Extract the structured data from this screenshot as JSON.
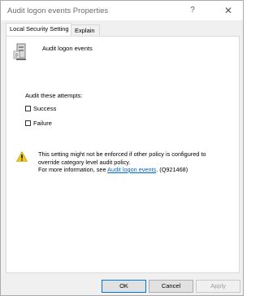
{
  "window": {
    "title": "Audit logon events Properties",
    "help_glyph": "?",
    "close_glyph": "✕"
  },
  "tabs": [
    {
      "label": "Local Security Setting",
      "active": true
    },
    {
      "label": "Explain",
      "active": false
    }
  ],
  "policy": {
    "name": "Audit logon events",
    "icon": "server-policy-icon"
  },
  "audit": {
    "heading": "Audit these attempts:",
    "options": [
      {
        "label": "Success",
        "checked": false
      },
      {
        "label": "Failure",
        "checked": false
      }
    ]
  },
  "warning": {
    "icon": "warning-icon",
    "line1": "This setting might not be enforced if other policy is configured to",
    "line2": "override category level audit policy.",
    "line3_prefix": "For more information, see ",
    "link_text": "Audit logon events",
    "line3_suffix": ". (Q921468)"
  },
  "buttons": {
    "ok": "OK",
    "cancel": "Cancel",
    "apply": "Apply"
  },
  "colors": {
    "link": "#0066cc",
    "warning": "#f2c811",
    "focus_border": "#0078d7"
  }
}
